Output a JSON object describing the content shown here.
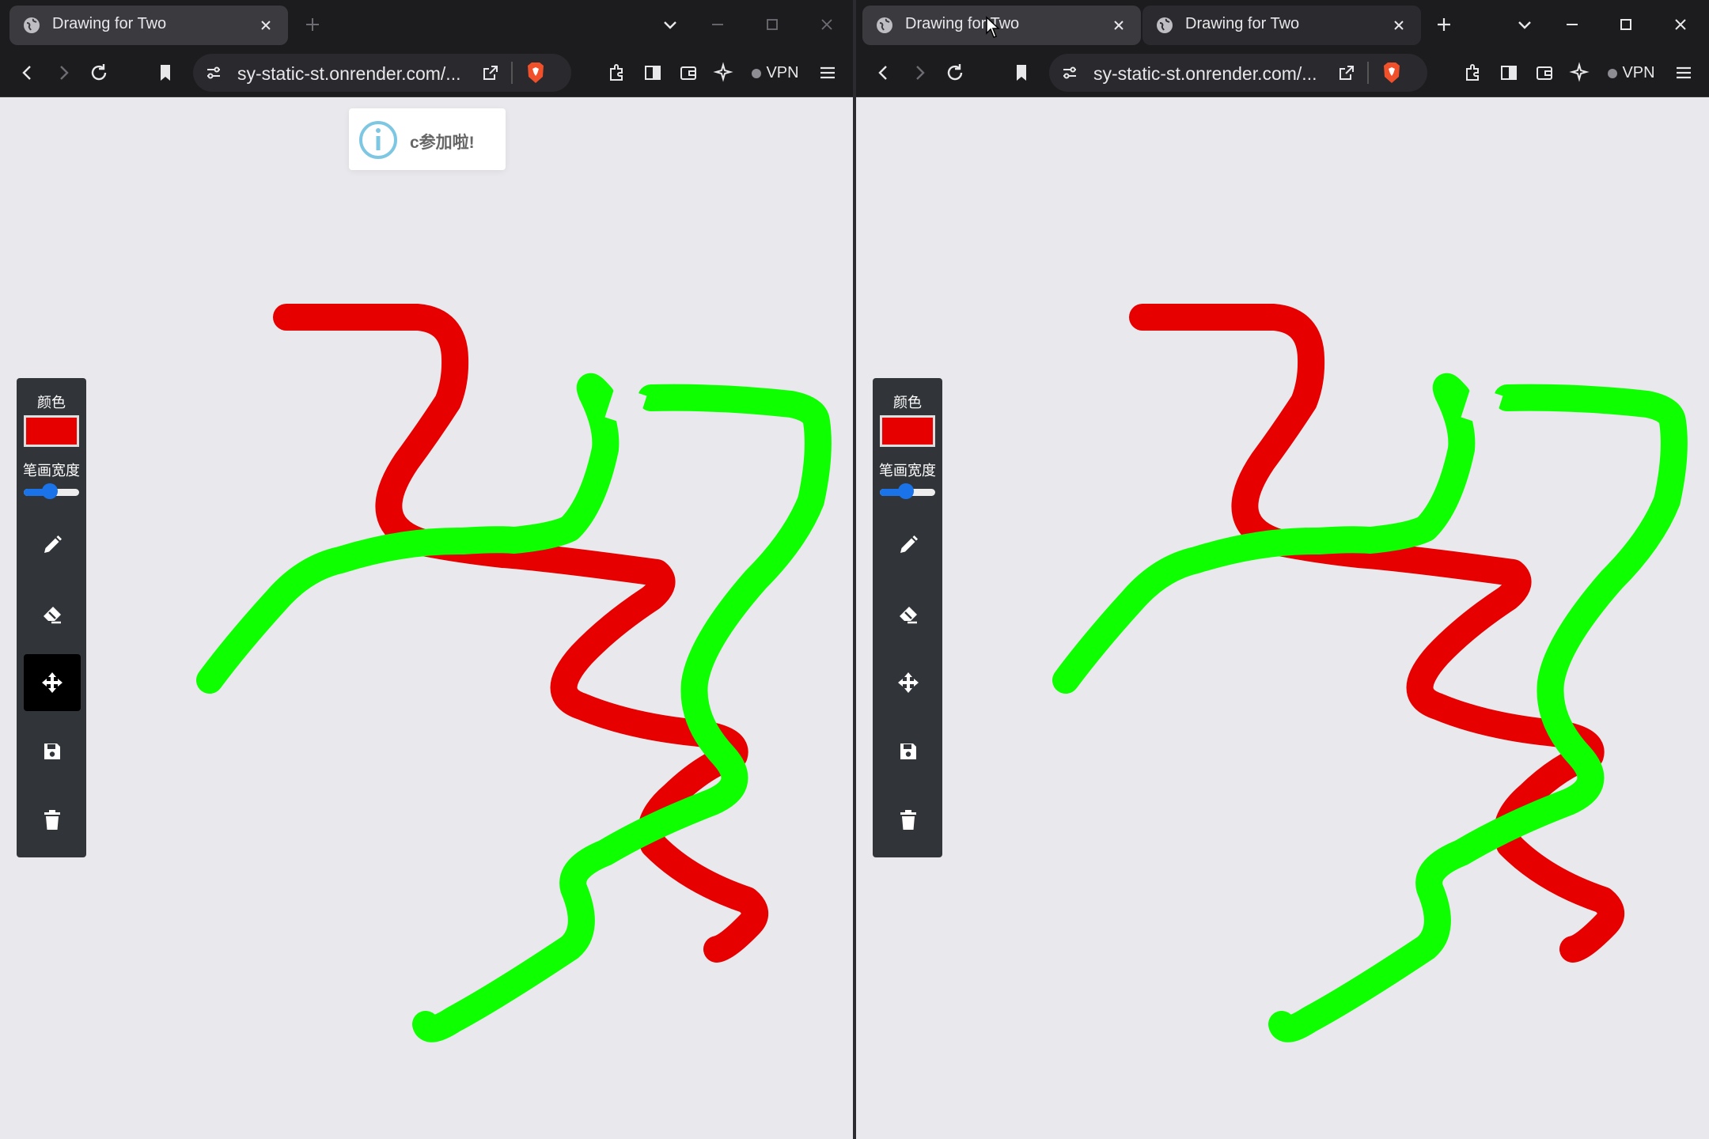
{
  "windows": [
    {
      "id": "left",
      "tabs": [
        {
          "title": "Drawing for Two",
          "active": true
        }
      ],
      "address": "sy-static-st.onrender.com/...",
      "vpn_label": "VPN",
      "toast": {
        "text": "c参加啦!",
        "icon": "info-icon"
      },
      "toolbar": {
        "color_label": "颜色",
        "color": "#e60000",
        "width_label": "笔画宽度",
        "width_value": 0.35,
        "active_tool": "move"
      }
    },
    {
      "id": "right",
      "tabs": [
        {
          "title": "Drawing for Two",
          "active": true
        },
        {
          "title": "Drawing for Two",
          "active": false
        }
      ],
      "address": "sy-static-st.onrender.com/...",
      "vpn_label": "VPN",
      "toolbar": {
        "color_label": "颜色",
        "color": "#e60000",
        "width_label": "笔画宽度",
        "width_value": 0.35,
        "active_tool": "none"
      }
    }
  ],
  "stroke_colors": {
    "red": "#e60000",
    "green": "#0dff00"
  }
}
